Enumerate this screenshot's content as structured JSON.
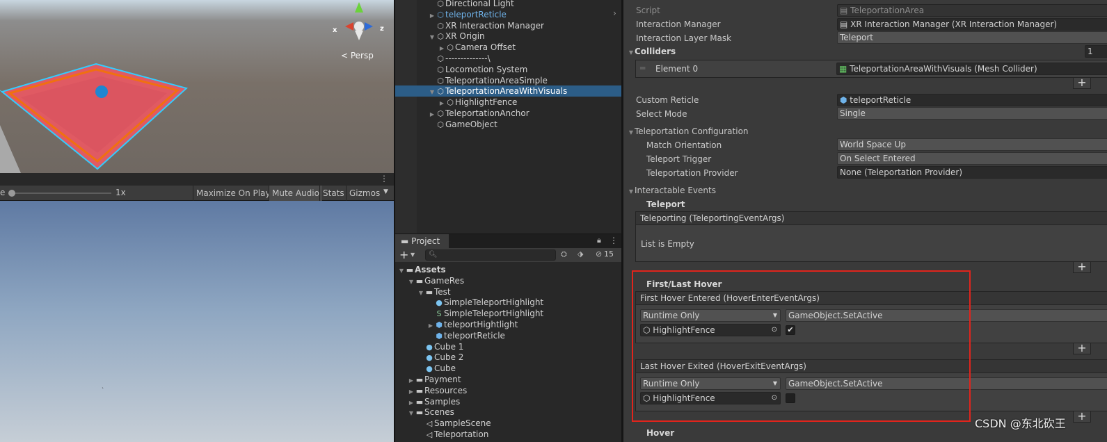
{
  "scene_view": {
    "persp_label": "< Persp",
    "axis_x": "x",
    "axis_z": "z"
  },
  "game_view": {
    "scale_label": "e",
    "scale_value": "1x",
    "buttons": [
      "Maximize On Play",
      "Mute Audio",
      "Stats",
      "Gizmos"
    ]
  },
  "hierarchy": {
    "items": [
      {
        "label": "Directional Light",
        "indent": 0,
        "arrow": ""
      },
      {
        "label": "teleportReticle",
        "indent": 0,
        "arrow": "right",
        "prefab": true
      },
      {
        "label": "XR Interaction Manager",
        "indent": 0,
        "arrow": ""
      },
      {
        "label": "XR Origin",
        "indent": 0,
        "arrow": "down"
      },
      {
        "label": "Camera Offset",
        "indent": 1,
        "arrow": "right"
      },
      {
        "label": "--------------\\",
        "indent": 0,
        "arrow": ""
      },
      {
        "label": "Locomotion System",
        "indent": 0,
        "arrow": ""
      },
      {
        "label": "TeleportationAreaSimple",
        "indent": 0,
        "arrow": ""
      },
      {
        "label": "TeleportationAreaWithVisuals",
        "indent": 0,
        "arrow": "down",
        "selected": true
      },
      {
        "label": "HighlightFence",
        "indent": 1,
        "arrow": "right"
      },
      {
        "label": "TeleportationAnchor",
        "indent": 0,
        "arrow": "right"
      },
      {
        "label": "GameObject",
        "indent": 0,
        "arrow": ""
      }
    ]
  },
  "project": {
    "tab_label": "Project",
    "hidden_count": "15",
    "items": [
      {
        "label": "Assets",
        "indent": 0,
        "arrow": "down",
        "icon": "folder",
        "bold": true
      },
      {
        "label": "GameRes",
        "indent": 1,
        "arrow": "down",
        "icon": "folder"
      },
      {
        "label": "Test",
        "indent": 2,
        "arrow": "down",
        "icon": "folder"
      },
      {
        "label": "SimpleTeleportHighlight",
        "indent": 3,
        "arrow": "",
        "icon": "sphere"
      },
      {
        "label": "SimpleTeleportHighlight",
        "indent": 3,
        "arrow": "",
        "icon": "shader"
      },
      {
        "label": "teleportHightlight",
        "indent": 3,
        "arrow": "right",
        "icon": "prefab"
      },
      {
        "label": "teleportReticle",
        "indent": 3,
        "arrow": "",
        "icon": "prefab"
      },
      {
        "label": "Cube 1",
        "indent": 2,
        "arrow": "",
        "icon": "sphere"
      },
      {
        "label": "Cube 2",
        "indent": 2,
        "arrow": "",
        "icon": "sphere"
      },
      {
        "label": "Cube",
        "indent": 2,
        "arrow": "",
        "icon": "sphere"
      },
      {
        "label": "Payment",
        "indent": 1,
        "arrow": "right",
        "icon": "folder"
      },
      {
        "label": "Resources",
        "indent": 1,
        "arrow": "right",
        "icon": "folder"
      },
      {
        "label": "Samples",
        "indent": 1,
        "arrow": "right",
        "icon": "folder"
      },
      {
        "label": "Scenes",
        "indent": 1,
        "arrow": "down",
        "icon": "folder"
      },
      {
        "label": "SampleScene",
        "indent": 2,
        "arrow": "",
        "icon": "unity"
      },
      {
        "label": "Teleportation",
        "indent": 2,
        "arrow": "",
        "icon": "unity"
      }
    ]
  },
  "inspector": {
    "script_label": "Script",
    "script_value": "TeleportationArea",
    "interaction_manager_label": "Interaction Manager",
    "interaction_manager_value": "XR Interaction Manager (XR Interaction Manager)",
    "layer_mask_label": "Interaction Layer Mask",
    "layer_mask_value": "Teleport",
    "colliders_label": "Colliders",
    "colliders_count": "1",
    "element0_label": "Element 0",
    "element0_value": "TeleportationAreaWithVisuals (Mesh Collider)",
    "custom_reticle_label": "Custom Reticle",
    "custom_reticle_value": "teleportReticle",
    "select_mode_label": "Select Mode",
    "select_mode_value": "Single",
    "teleport_config_label": "Teleportation Configuration",
    "match_orientation_label": "Match Orientation",
    "match_orientation_value": "World Space Up",
    "teleport_trigger_label": "Teleport Trigger",
    "teleport_trigger_value": "On Select Entered",
    "teleport_provider_label": "Teleportation Provider",
    "teleport_provider_value": "None (Teleportation Provider)",
    "interactable_events_label": "Interactable Events",
    "teleport_section": "Teleport",
    "teleporting_header": "Teleporting (TeleportingEventArgs)",
    "list_empty": "List is Empty",
    "first_last_hover": "First/Last Hover",
    "first_hover_header": "First Hover Entered (HoverEnterEventArgs)",
    "first_runtime": "Runtime Only",
    "first_function": "GameObject.SetActive",
    "first_object": "HighlightFence",
    "first_checked": "✔",
    "last_hover_header": "Last Hover Exited (HoverExitEventArgs)",
    "last_runtime": "Runtime Only",
    "last_function": "GameObject.SetActive",
    "last_object": "HighlightFence",
    "hover_label": "Hover"
  },
  "watermark": "CSDN @东北砍王",
  "colors": {
    "selection": "#2c5d87",
    "highlight_box": "#e1241c",
    "prefab_blue": "#6fb3ea"
  }
}
